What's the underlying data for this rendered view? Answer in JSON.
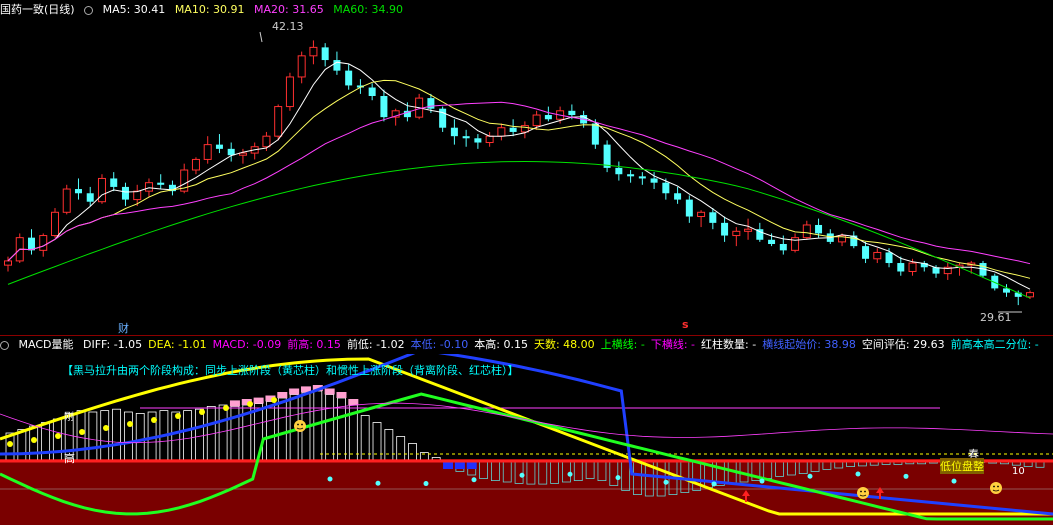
{
  "top_header": {
    "title": "国药一致(日线)",
    "ma5": "MA5: 30.41",
    "ma10": "MA10: 30.91",
    "ma20": "MA20: 31.65",
    "ma60": "MA60: 34.90"
  },
  "bottom_header": {
    "title": "MACD量能",
    "items": [
      {
        "text": "DIFF: -1.05",
        "color": "#ffffff"
      },
      {
        "text": "DEA: -1.01",
        "color": "#ffff00"
      },
      {
        "text": "MACD: -0.09",
        "color": "#ff00ff"
      },
      {
        "text": "前高: 0.15",
        "color": "#ff00ff"
      },
      {
        "text": "前低: -1.02",
        "color": "#ffffff"
      },
      {
        "text": "本低: -0.10",
        "color": "#4060ff"
      },
      {
        "text": "本高: 0.15",
        "color": "#ffffff"
      },
      {
        "text": "天数: 48.00",
        "color": "#ffff00"
      },
      {
        "text": "上横线: -",
        "color": "#00ff00"
      },
      {
        "text": "下横线: -",
        "color": "#ff00ff"
      },
      {
        "text": "红柱数量: -",
        "color": "#ffffff"
      },
      {
        "text": "横线起始价: 38.98",
        "color": "#4060ff"
      },
      {
        "text": "空间评估: 29.63",
        "color": "#ffffff"
      },
      {
        "text": "前高本高二分位: -",
        "color": "#00ffff"
      }
    ]
  },
  "annotations": {
    "high_label": "42.13",
    "low_label": "29.61",
    "cai_marker": "财",
    "s_marker": "s",
    "phase_text": "【黑马拉升由两个阶段构成：同步上涨阶段（黄芯柱）和惯性上涨阶段（背离阶段、红芯柱）】",
    "gao": "高",
    "gang": "刚",
    "chun": "春",
    "low_price": "低位盘整",
    "ten": "10"
  },
  "colors": {
    "up": "#ff3030",
    "down": "#54ffff",
    "ma5": "#ffffff",
    "ma10": "#ffff60",
    "ma20": "#ff40ff",
    "ma60": "#00e000",
    "bg": "#000000",
    "lower_bg": "#7a0000"
  },
  "chart_data": {
    "type": "candlestick",
    "price_range": [
      29.61,
      42.13
    ],
    "candles_ohlc": [
      [
        31.5,
        31.9,
        31.2,
        31.7
      ],
      [
        31.7,
        33.0,
        31.6,
        32.8
      ],
      [
        32.8,
        33.2,
        32.0,
        32.2
      ],
      [
        32.2,
        33.0,
        31.9,
        32.9
      ],
      [
        32.9,
        34.2,
        32.8,
        34.0
      ],
      [
        34.0,
        35.3,
        33.9,
        35.1
      ],
      [
        35.1,
        35.6,
        34.6,
        34.9
      ],
      [
        34.9,
        35.2,
        34.3,
        34.5
      ],
      [
        34.5,
        35.8,
        34.4,
        35.6
      ],
      [
        35.6,
        35.9,
        35.0,
        35.2
      ],
      [
        35.2,
        35.4,
        34.3,
        34.6
      ],
      [
        34.6,
        35.3,
        34.3,
        35.0
      ],
      [
        35.0,
        35.6,
        34.7,
        35.4
      ],
      [
        35.4,
        35.8,
        35.1,
        35.3
      ],
      [
        35.3,
        35.5,
        34.8,
        35.0
      ],
      [
        35.0,
        36.3,
        34.9,
        36.0
      ],
      [
        36.0,
        36.6,
        35.8,
        36.5
      ],
      [
        36.5,
        37.6,
        36.3,
        37.2
      ],
      [
        37.2,
        37.7,
        36.8,
        37.0
      ],
      [
        37.0,
        37.3,
        36.4,
        36.7
      ],
      [
        36.7,
        37.0,
        36.3,
        36.8
      ],
      [
        36.8,
        37.3,
        36.5,
        37.1
      ],
      [
        37.1,
        37.8,
        36.9,
        37.6
      ],
      [
        37.6,
        39.1,
        37.4,
        39.0
      ],
      [
        39.0,
        40.6,
        38.8,
        40.4
      ],
      [
        40.4,
        41.6,
        40.1,
        41.4
      ],
      [
        41.4,
        42.13,
        41.0,
        41.8
      ],
      [
        41.8,
        42.0,
        40.9,
        41.2
      ],
      [
        41.2,
        41.6,
        40.5,
        40.7
      ],
      [
        40.7,
        41.0,
        39.8,
        40.0
      ],
      [
        40.0,
        40.3,
        39.6,
        39.9
      ],
      [
        39.9,
        40.1,
        39.3,
        39.5
      ],
      [
        39.5,
        39.8,
        38.3,
        38.5
      ],
      [
        38.5,
        38.9,
        38.1,
        38.8
      ],
      [
        38.8,
        39.2,
        38.3,
        38.5
      ],
      [
        38.5,
        39.6,
        38.4,
        39.4
      ],
      [
        39.4,
        39.6,
        38.7,
        38.9
      ],
      [
        38.9,
        39.0,
        37.8,
        38.0
      ],
      [
        38.0,
        38.4,
        37.2,
        37.6
      ],
      [
        37.6,
        37.9,
        37.1,
        37.5
      ],
      [
        37.5,
        37.7,
        37.0,
        37.3
      ],
      [
        37.3,
        37.8,
        37.1,
        37.6
      ],
      [
        37.6,
        38.2,
        37.4,
        38.0
      ],
      [
        38.0,
        38.4,
        37.6,
        37.8
      ],
      [
        37.8,
        38.3,
        37.5,
        38.1
      ],
      [
        38.1,
        38.8,
        37.9,
        38.6
      ],
      [
        38.6,
        39.0,
        38.3,
        38.4
      ],
      [
        38.4,
        39.0,
        38.2,
        38.8
      ],
      [
        38.8,
        39.1,
        38.4,
        38.6
      ],
      [
        38.6,
        38.8,
        38.0,
        38.2
      ],
      [
        38.2,
        38.4,
        37.0,
        37.2
      ],
      [
        37.2,
        37.4,
        35.9,
        36.1
      ],
      [
        36.1,
        36.4,
        35.5,
        35.8
      ],
      [
        35.8,
        36.0,
        35.4,
        35.7
      ],
      [
        35.7,
        35.9,
        35.3,
        35.6
      ],
      [
        35.6,
        35.9,
        35.1,
        35.4
      ],
      [
        35.4,
        35.6,
        34.6,
        34.9
      ],
      [
        34.9,
        35.2,
        34.4,
        34.6
      ],
      [
        34.6,
        34.8,
        33.5,
        33.8
      ],
      [
        33.8,
        34.1,
        33.3,
        34.0
      ],
      [
        34.0,
        34.2,
        33.2,
        33.5
      ],
      [
        33.5,
        33.8,
        32.6,
        32.9
      ],
      [
        32.9,
        33.3,
        32.4,
        33.1
      ],
      [
        33.1,
        33.7,
        32.7,
        33.2
      ],
      [
        33.2,
        33.5,
        32.6,
        32.7
      ],
      [
        32.7,
        33.0,
        32.4,
        32.5
      ],
      [
        32.5,
        32.9,
        32.0,
        32.2
      ],
      [
        32.2,
        33.0,
        32.1,
        32.8
      ],
      [
        32.8,
        33.6,
        32.7,
        33.4
      ],
      [
        33.4,
        33.7,
        32.8,
        33.0
      ],
      [
        33.0,
        33.2,
        32.5,
        32.6
      ],
      [
        32.6,
        33.0,
        32.4,
        32.9
      ],
      [
        32.9,
        33.1,
        32.3,
        32.4
      ],
      [
        32.4,
        32.6,
        31.6,
        31.8
      ],
      [
        31.8,
        32.3,
        31.6,
        32.1
      ],
      [
        32.1,
        32.3,
        31.4,
        31.6
      ],
      [
        31.6,
        31.9,
        31.0,
        31.2
      ],
      [
        31.2,
        31.8,
        31.0,
        31.6
      ],
      [
        31.6,
        31.7,
        31.2,
        31.4
      ],
      [
        31.4,
        31.5,
        30.9,
        31.1
      ],
      [
        31.1,
        31.6,
        30.8,
        31.4
      ],
      [
        31.4,
        31.6,
        31.0,
        31.5
      ],
      [
        31.5,
        31.7,
        31.1,
        31.6
      ],
      [
        31.6,
        31.7,
        30.9,
        31.0
      ],
      [
        31.0,
        31.1,
        30.3,
        30.4
      ],
      [
        30.4,
        30.6,
        30.0,
        30.2
      ],
      [
        30.2,
        30.3,
        29.61,
        30.0
      ],
      [
        30.0,
        30.3,
        29.9,
        30.2
      ]
    ],
    "macd_bars": [
      0.4,
      0.45,
      0.5,
      0.55,
      0.6,
      0.68,
      0.72,
      0.7,
      0.72,
      0.74,
      0.7,
      0.68,
      0.7,
      0.72,
      0.7,
      0.72,
      0.74,
      0.78,
      0.8,
      0.78,
      0.8,
      0.82,
      0.85,
      0.9,
      0.95,
      0.98,
      1.0,
      0.95,
      0.9,
      0.8,
      0.65,
      0.55,
      0.45,
      0.35,
      0.25,
      0.12,
      0.05,
      -0.05,
      -0.15,
      -0.2,
      -0.25,
      -0.28,
      -0.3,
      -0.32,
      -0.33,
      -0.33,
      -0.32,
      -0.3,
      -0.28,
      -0.25,
      -0.28,
      -0.35,
      -0.42,
      -0.48,
      -0.5,
      -0.5,
      -0.48,
      -0.45,
      -0.42,
      -0.38,
      -0.35,
      -0.33,
      -0.3,
      -0.28,
      -0.25,
      -0.22,
      -0.2,
      -0.18,
      -0.15,
      -0.12,
      -0.1,
      -0.08,
      -0.07,
      -0.06,
      -0.05,
      -0.05,
      -0.04,
      -0.04,
      -0.03,
      -0.03,
      -0.03,
      -0.02,
      -0.02,
      -0.03,
      -0.04,
      -0.06,
      -0.08,
      -0.09
    ]
  }
}
